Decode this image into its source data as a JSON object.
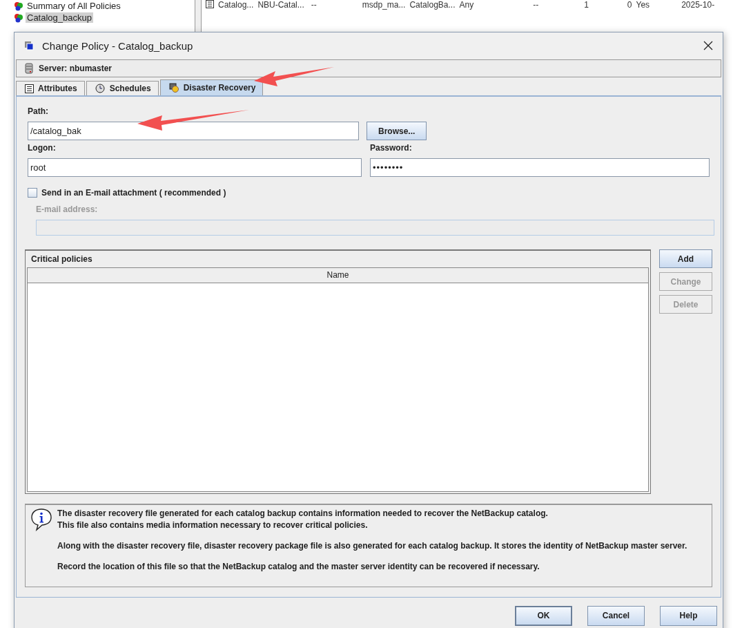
{
  "background": {
    "tree": [
      {
        "label": "Summary of All Policies",
        "selected": false
      },
      {
        "label": "Catalog_backup",
        "selected": true
      }
    ],
    "policy_row": [
      "Catalog...",
      "NBU-Catal...",
      "--",
      "msdp_ma...",
      "CatalogBa...",
      "Any",
      "--",
      "1",
      "0",
      "Yes",
      "2025-10-"
    ]
  },
  "window": {
    "title": "Change Policy - Catalog_backup"
  },
  "server": {
    "label": "Server:",
    "name": "nbumaster"
  },
  "tabs": [
    {
      "label": "Attributes",
      "kind": "attributes",
      "selected": false
    },
    {
      "label": "Schedules",
      "kind": "schedules",
      "selected": false
    },
    {
      "label": "Disaster Recovery",
      "kind": "recovery",
      "selected": true
    }
  ],
  "path": {
    "label": "Path:",
    "value": "/catalog_bak"
  },
  "browse_button": {
    "label": "Browse..."
  },
  "logon": {
    "label": "Logon:",
    "value": "root"
  },
  "password": {
    "label": "Password:",
    "value": "••••••••"
  },
  "email_attachment": {
    "label": "Send in an E-mail attachment ( recommended )",
    "checked": false
  },
  "email_address": {
    "label": "E-mail address:",
    "disabled": true
  },
  "critical_policies": {
    "title": "Critical policies",
    "columns": [
      "Name"
    ]
  },
  "policy_buttons": [
    {
      "label": "Add",
      "disabled": false
    },
    {
      "label": "Change",
      "disabled": true
    },
    {
      "label": "Delete",
      "disabled": true
    }
  ],
  "info": [
    "The disaster recovery file generated for each catalog backup contains information needed to recover the NetBackup catalog.\nThis file also contains media information necessary to recover critical policies.",
    "Along with the disaster recovery file, disaster recovery package file is also generated for each catalog backup. It stores the identity of NetBackup master server.",
    "Record the location of this file so that the NetBackup catalog and the master server identity can be recovered if necessary."
  ],
  "dialog_buttons": [
    {
      "label": "OK",
      "default": true
    },
    {
      "label": "Cancel",
      "default": false
    },
    {
      "label": "Help",
      "default": false
    }
  ]
}
